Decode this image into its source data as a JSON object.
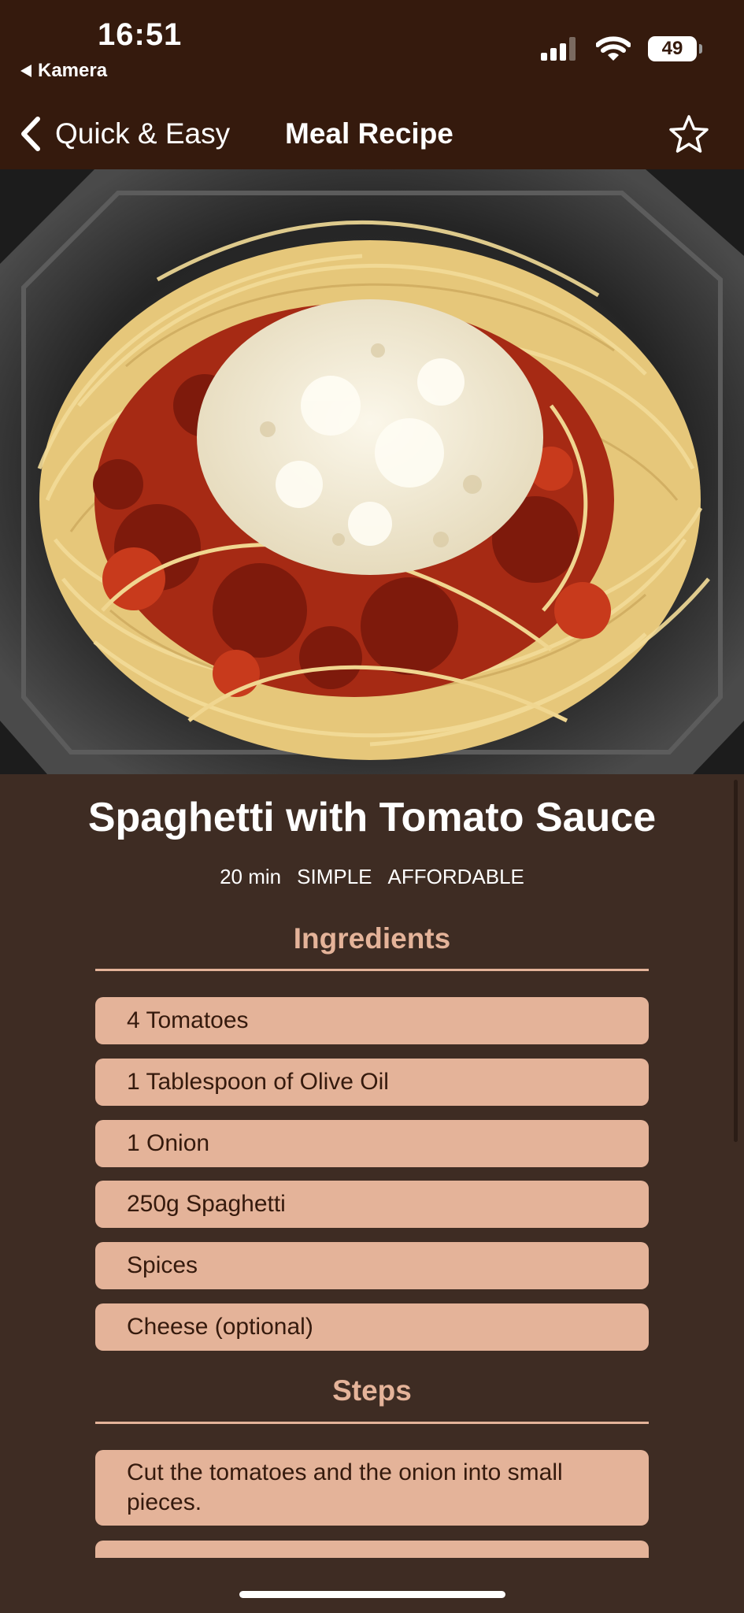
{
  "status": {
    "time": "16:51",
    "back_app": "Kamera",
    "battery": "49"
  },
  "nav": {
    "back_label": "Quick & Easy",
    "title": "Meal Recipe"
  },
  "recipe": {
    "title": "Spaghetti with Tomato Sauce",
    "duration": "20 min",
    "complexity": "SIMPLE",
    "affordability": "AFFORDABLE"
  },
  "ingredients": {
    "heading": "Ingredients",
    "items": [
      "4 Tomatoes",
      "1 Tablespoon of Olive Oil",
      "1 Onion",
      "250g Spaghetti",
      "Spices",
      "Cheese (optional)"
    ]
  },
  "steps": {
    "heading": "Steps",
    "items": [
      "Cut the tomatoes and the onion into small pieces."
    ]
  },
  "colors": {
    "header_bg": "#351a0d",
    "page_bg": "#3e2c23",
    "accent": "#e4b399"
  },
  "icons": [
    "signal-icon",
    "wifi-icon",
    "battery-icon",
    "chevron-left-icon",
    "star-icon"
  ]
}
